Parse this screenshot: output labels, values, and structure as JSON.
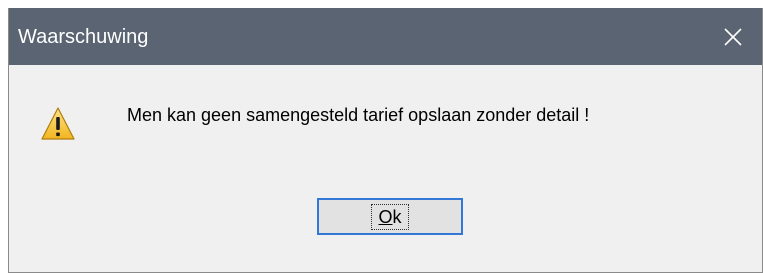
{
  "window": {
    "title": "Waarschuwing",
    "close_icon": "close-icon",
    "titlebar_color": "#5a6472",
    "body_color": "#f0f0f0"
  },
  "message": {
    "icon": "warning-icon",
    "text": "Men kan geen samengesteld tarief opslaan zonder detail !"
  },
  "buttons": {
    "ok_mnemonic": "O",
    "ok_rest": "k",
    "focus_color": "#3278d7"
  }
}
